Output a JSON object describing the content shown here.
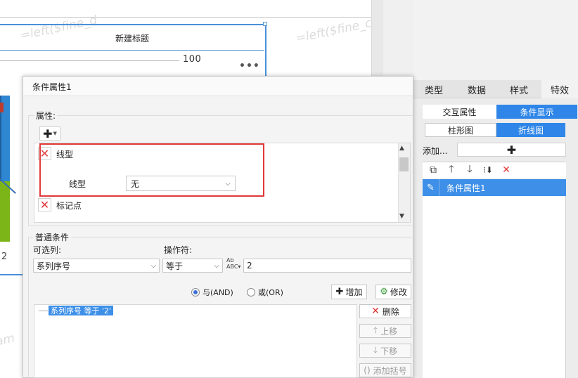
{
  "canvas": {
    "chart_title": "新建标题",
    "axis_value": "100",
    "axis_category": "2",
    "watermark": "=left($fine_d",
    "watermark2": "=left($fine_c",
    "watermark3": "am"
  },
  "right_panel": {
    "tabs": [
      {
        "label": "类型"
      },
      {
        "label": "数据"
      },
      {
        "label": "样式"
      },
      {
        "label": "特效"
      }
    ],
    "subtabs": [
      {
        "label": "交互属性"
      },
      {
        "label": "条件显示"
      }
    ],
    "chart_types": [
      {
        "label": "柱形图"
      },
      {
        "label": "折线图"
      }
    ],
    "add_label": "添加...",
    "list_items": [
      {
        "label": "条件属性1"
      }
    ]
  },
  "dialog": {
    "title": "条件属性1",
    "attributes_label": "属性:",
    "line_type_header": "线型",
    "line_type_label": "线型",
    "line_type_value": "无",
    "marker_label": "标记点",
    "general_conditions_label": "普通条件",
    "column_label": "可选列:",
    "operator_label": "操作符:",
    "column_value": "系列序号",
    "operator_value": "等于",
    "value_input": "2",
    "radio_and": "与(AND)",
    "radio_or": "或(OR)",
    "add_button": "增加",
    "modify_button": "修改",
    "condition_item": "系列序号 等于 '2'",
    "delete_button": "删除",
    "move_up_button": "上移",
    "move_down_button": "下移",
    "add_bracket_button": "添加括号"
  },
  "colors": {
    "accent": "#2f86e8",
    "highlight_box": "#e03a3a",
    "delete_icon": "#e03a3a"
  }
}
